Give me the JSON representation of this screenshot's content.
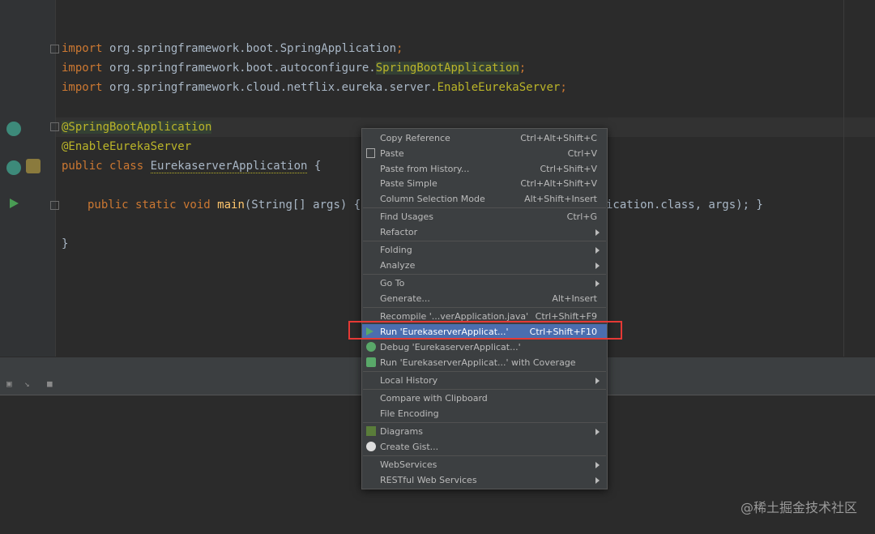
{
  "editor": {
    "imports": [
      {
        "kw": "import",
        "pkg": "org.springframework.boot.",
        "cls": "SpringApplication",
        "end": ";"
      },
      {
        "kw": "import",
        "pkg": "org.springframework.boot.autoconfigure.",
        "cls": "SpringBootApplication",
        "end": ";"
      },
      {
        "kw": "import",
        "pkg": "org.springframework.cloud.netflix.eureka.server.",
        "cls": "EnableEurekaServer",
        "end": ";"
      }
    ],
    "annotation1": "@SpringBootApplication",
    "annotation2": "@EnableEurekaServer",
    "class_decl_kw": "public class ",
    "class_name": "EurekaserverApplication",
    "class_brace": " {",
    "main_kw": "public static void ",
    "main_name": "main",
    "main_params": "(String[] args) { S",
    "main_tail": "ication.class, args); }",
    "close_brace": "}"
  },
  "menu": {
    "items": [
      {
        "label": "Copy Reference",
        "shortcut": "Ctrl+Alt+Shift+C"
      },
      {
        "label": "Paste",
        "shortcut": "Ctrl+V",
        "icon": "paste-icon"
      },
      {
        "label": "Paste from History...",
        "shortcut": "Ctrl+Shift+V"
      },
      {
        "label": "Paste Simple",
        "shortcut": "Ctrl+Alt+Shift+V"
      },
      {
        "label": "Column Selection Mode",
        "shortcut": "Alt+Shift+Insert"
      },
      {
        "label": "Find Usages",
        "shortcut": "Ctrl+G"
      },
      {
        "label": "Refactor",
        "submenu": true
      },
      {
        "label": "Folding",
        "submenu": true
      },
      {
        "label": "Analyze",
        "submenu": true
      },
      {
        "label": "Go To",
        "submenu": true
      },
      {
        "label": "Generate...",
        "shortcut": "Alt+Insert"
      },
      {
        "label": "Recompile '...verApplication.java'",
        "shortcut": "Ctrl+Shift+F9"
      },
      {
        "label": "Run 'EurekaserverApplicat...'",
        "shortcut": "Ctrl+Shift+F10",
        "selected": true,
        "icon": "run-icon"
      },
      {
        "label": "Debug 'EurekaserverApplicat...'",
        "icon": "debug-icon"
      },
      {
        "label": "Run 'EurekaserverApplicat...' with Coverage",
        "icon": "coverage-icon"
      },
      {
        "label": "Local History",
        "submenu": true
      },
      {
        "label": "Compare with Clipboard",
        "icon": "compare-icon"
      },
      {
        "label": "File Encoding"
      },
      {
        "label": "Diagrams",
        "submenu": true,
        "icon": "diagrams-icon"
      },
      {
        "label": "Create Gist...",
        "icon": "github-icon"
      },
      {
        "label": "WebServices",
        "submenu": true
      },
      {
        "label": "RESTful Web Services",
        "submenu": true
      }
    ]
  },
  "watermark": "@稀土掘金技术社区",
  "colors": {
    "selection": "#4b6eaf",
    "highlight_box": "#e53935",
    "menu_bg": "#3c3f41",
    "editor_bg": "#2b2b2b"
  }
}
